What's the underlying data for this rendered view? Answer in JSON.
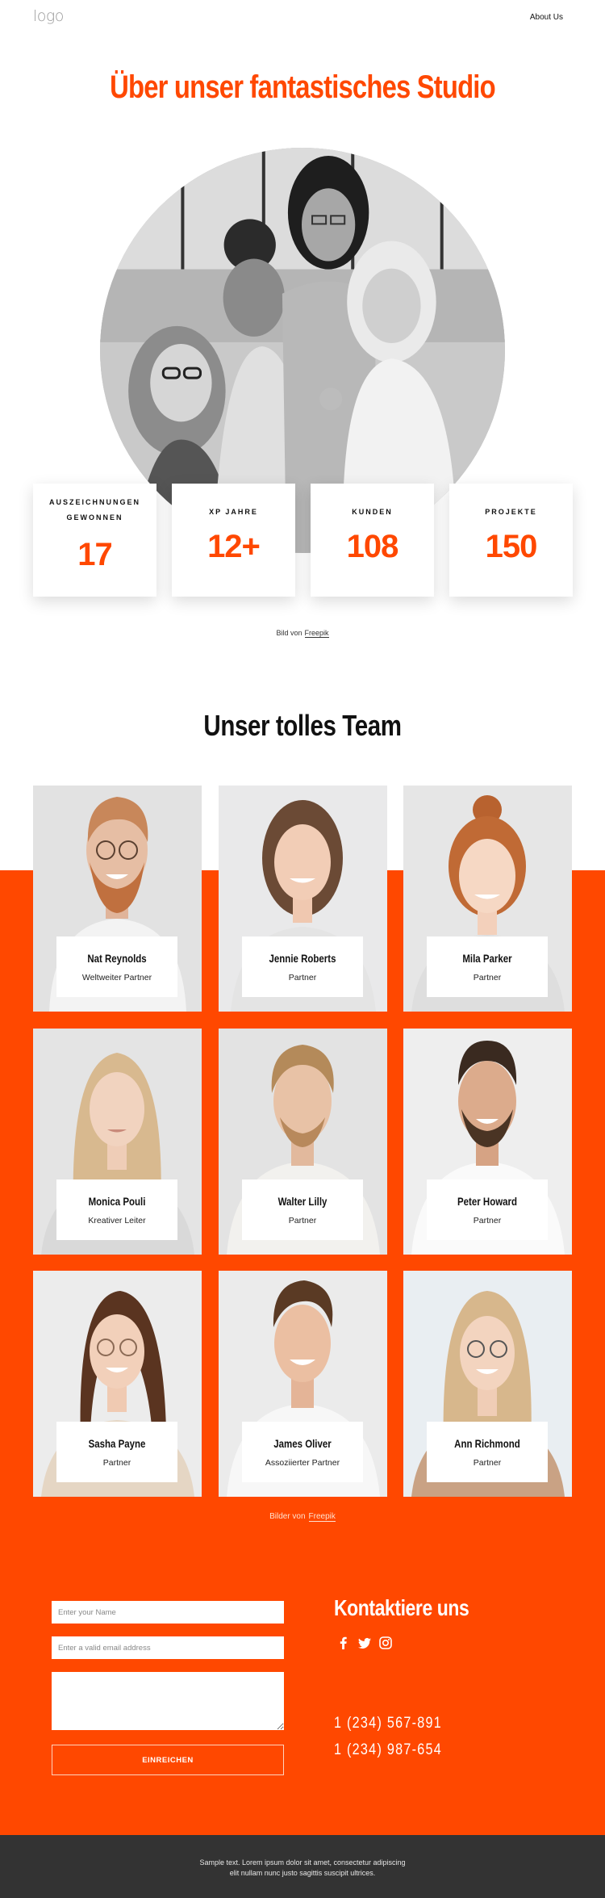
{
  "header": {
    "logo": "logo",
    "nav": [
      {
        "label": "About Us"
      }
    ]
  },
  "hero": {
    "title": "Über unser fantastisches Studio",
    "image_alt": "group-photo"
  },
  "stats": [
    {
      "label": "AUSZEICHNUNGEN GEWONNEN",
      "value": "17"
    },
    {
      "label": "XP JAHRE",
      "value": "12+"
    },
    {
      "label": "KUNDEN",
      "value": "108"
    },
    {
      "label": "PROJEKTE",
      "value": "150"
    }
  ],
  "hero_credit": {
    "prefix": "Bild von",
    "link": "Freepik"
  },
  "team": {
    "title": "Unser tolles Team",
    "members": [
      {
        "name": "Nat Reynolds",
        "role": "Weltweiter Partner"
      },
      {
        "name": "Jennie Roberts",
        "role": "Partner"
      },
      {
        "name": "Mila Parker",
        "role": "Partner"
      },
      {
        "name": "Monica Pouli",
        "role": "Kreativer Leiter"
      },
      {
        "name": "Walter Lilly",
        "role": "Partner"
      },
      {
        "name": "Peter Howard",
        "role": "Partner"
      },
      {
        "name": "Sasha Payne",
        "role": "Partner"
      },
      {
        "name": "James Oliver",
        "role": "Assoziierter Partner"
      },
      {
        "name": "Ann Richmond",
        "role": "Partner"
      }
    ],
    "credit": {
      "prefix": "Bilder von",
      "link": "Freepik"
    }
  },
  "contact_form": {
    "name_placeholder": "Enter your Name",
    "email_placeholder": "Enter a valid email address",
    "message_placeholder": "",
    "submit_label": "EINREICHEN"
  },
  "contact": {
    "title": "Kontaktiere uns",
    "socials": [
      "facebook-icon",
      "twitter-icon",
      "instagram-icon"
    ],
    "phones": [
      "1 (234) 567-891",
      "1 (234) 987-654"
    ]
  },
  "footer": {
    "text": "Sample text. Lorem ipsum dolor sit amet, consectetur adipiscing elit nullam nunc justo sagittis suscipit ultrices."
  },
  "colors": {
    "accent": "#ff4800",
    "footer_bg": "#333333",
    "text": "#111111"
  }
}
